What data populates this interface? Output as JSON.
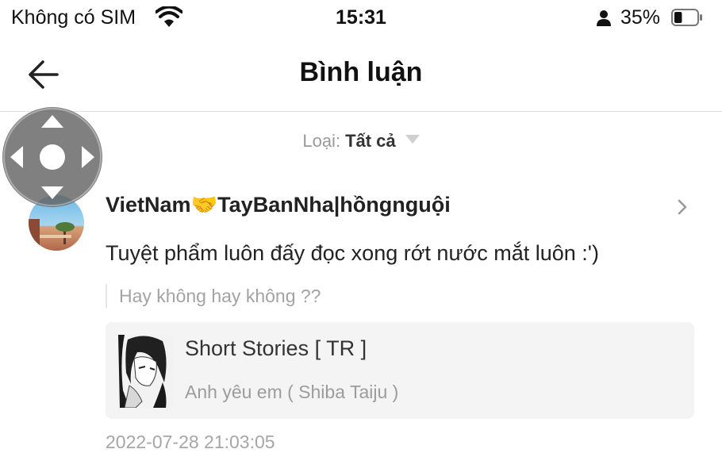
{
  "status_bar": {
    "carrier": "Không có SIM",
    "time": "15:31",
    "battery_percent": "35%",
    "battery_level": 0.35,
    "icons": [
      "wifi-icon",
      "person-icon",
      "battery-icon"
    ]
  },
  "nav": {
    "title": "Bình luận",
    "back_icon": "arrow-left-icon"
  },
  "filter": {
    "label": "Loại:",
    "value": "Tất cả",
    "icon": "caret-down-icon"
  },
  "assistive_touch": {
    "icon": "dpad-icon"
  },
  "comment": {
    "username": "VietNam🤝TayBanNha|hồngnguội",
    "text": "Tuyệt phẩm luôn đấy đọc  xong rớt nước mắt luôn :')",
    "quote": "Hay không hay không ??",
    "book": {
      "title": "Short Stories [ TR ]",
      "chapter": "Anh yêu em ( Shiba Taiju )"
    },
    "timestamp": "2022-07-28 21:03:05"
  },
  "colors": {
    "background": "#ffffff",
    "primary_text": "#222222",
    "secondary_text": "#a3a3a3",
    "card_background": "#f4f4f4",
    "divider": "#e2e2e2"
  }
}
